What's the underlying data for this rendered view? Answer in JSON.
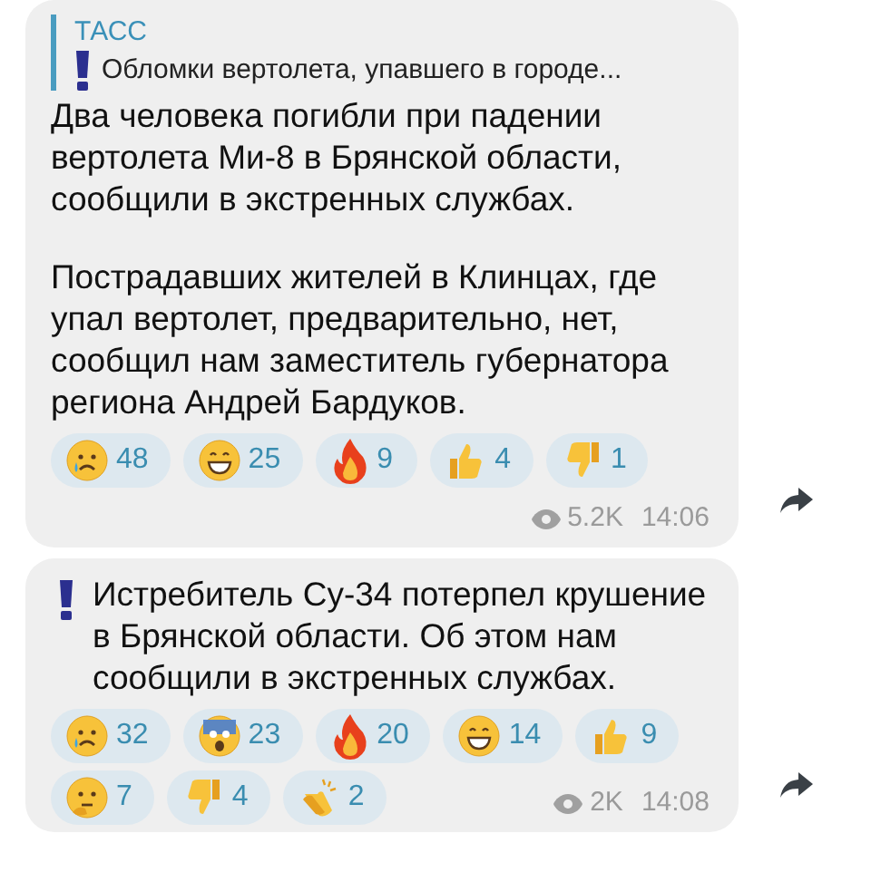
{
  "messages": [
    {
      "reply": {
        "author": "ТАСС",
        "quote": "Обломки вертолета, упавшего в городе..."
      },
      "paragraphs": [
        "Два человека погибли при падении вертолета Ми-8 в Брянской области, сообщили в экстренных службах.",
        "Пострадавших жителей в Клинцах, где упал вертолет, предварительно, нет, сообщил нам заместитель губернатора региона Андрей Бардуков."
      ],
      "reactions": [
        {
          "kind": "crying",
          "count": "48"
        },
        {
          "kind": "grin",
          "count": "25"
        },
        {
          "kind": "fire",
          "count": "9"
        },
        {
          "kind": "thumbs-up",
          "count": "4"
        },
        {
          "kind": "thumbs-down",
          "count": "1"
        }
      ],
      "views": "5.2K",
      "time": "14:06"
    },
    {
      "lead_icon": true,
      "paragraphs": [
        "Истребитель Су-34 потерпел крушение в Брянской области. Об этом нам сообщили в экстренных службах."
      ],
      "reactions": [
        {
          "kind": "crying",
          "count": "32"
        },
        {
          "kind": "scream",
          "count": "23"
        },
        {
          "kind": "fire",
          "count": "20"
        },
        {
          "kind": "grin",
          "count": "14"
        },
        {
          "kind": "thumbs-up",
          "count": "9"
        },
        {
          "kind": "thinking",
          "count": "7"
        },
        {
          "kind": "thumbs-down",
          "count": "4"
        },
        {
          "kind": "clap",
          "count": "2"
        }
      ],
      "views": "2K",
      "time": "14:08"
    }
  ]
}
